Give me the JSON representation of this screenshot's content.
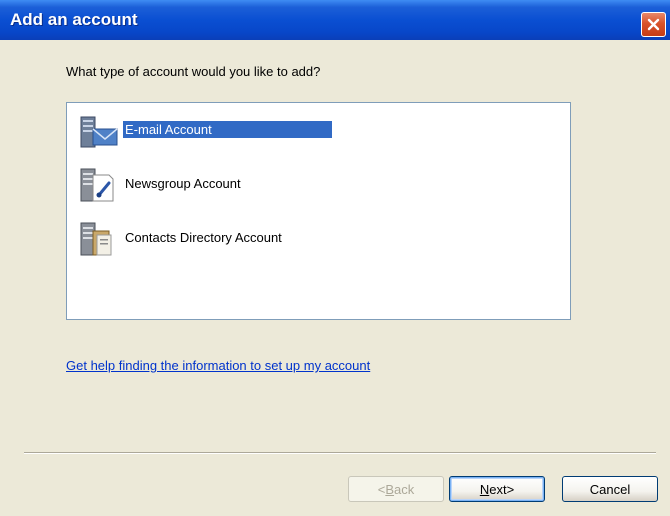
{
  "window": {
    "title": "Add an account"
  },
  "prompt": "What type of account would you like to add?",
  "account_types": [
    {
      "label": "E-mail Account",
      "icon": "email-account-icon",
      "selected": true
    },
    {
      "label": "Newsgroup Account",
      "icon": "newsgroup-account-icon",
      "selected": false
    },
    {
      "label": "Contacts Directory Account",
      "icon": "directory-account-icon",
      "selected": false
    }
  ],
  "help_link": "Get help finding the information to set up my account",
  "buttons": {
    "back": {
      "key": "B",
      "rest": "ack",
      "prefix": "< ",
      "disabled": true
    },
    "next": {
      "key": "N",
      "rest": "ext",
      "suffix": " >"
    },
    "cancel": "Cancel"
  },
  "colors": {
    "titlebar": "#0a4fd2",
    "selection": "#316ac5",
    "link": "#0033cc",
    "dialog_bg": "#ece9d8"
  }
}
